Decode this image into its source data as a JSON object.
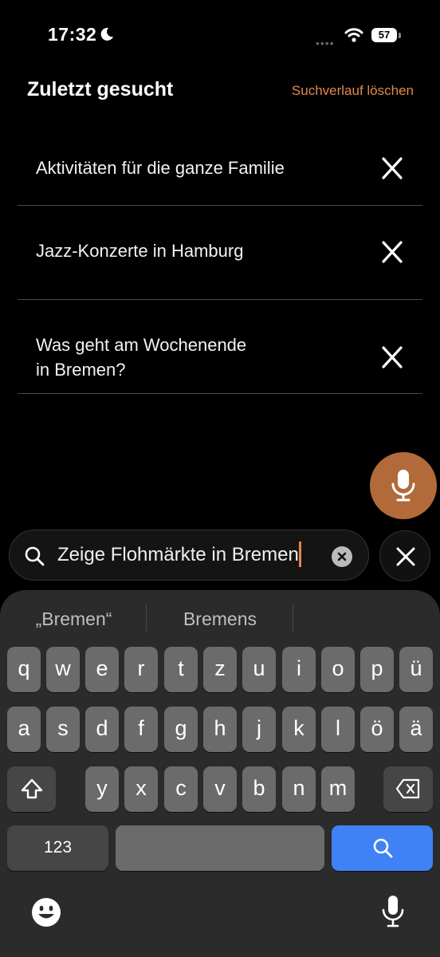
{
  "status": {
    "time": "17:32",
    "battery": "57"
  },
  "header": {
    "title": "Zuletzt gesucht",
    "clear_history": "Suchverlauf löschen"
  },
  "history": [
    {
      "line1": "Aktivitäten für die ganze Familie",
      "line2": ""
    },
    {
      "line1": "Jazz-Konzerte in Hamburg",
      "line2": ""
    },
    {
      "line1": "Was geht am Wochenende",
      "line2": "in Bremen?"
    }
  ],
  "search": {
    "value": "Zeige Flohmärkte in Bremen"
  },
  "keyboard": {
    "suggestions": [
      "„Bremen“",
      "Bremens"
    ],
    "row1": [
      "q",
      "w",
      "e",
      "r",
      "t",
      "z",
      "u",
      "i",
      "o",
      "p",
      "ü"
    ],
    "row2": [
      "a",
      "s",
      "d",
      "f",
      "g",
      "h",
      "j",
      "k",
      "l",
      "ö",
      "ä"
    ],
    "row3": [
      "y",
      "x",
      "c",
      "v",
      "b",
      "n",
      "m"
    ],
    "numbers_label": "123"
  },
  "colors": {
    "accent": "#e1874d",
    "mic_fab": "#b26a3a",
    "search_key": "#3f82f5"
  }
}
